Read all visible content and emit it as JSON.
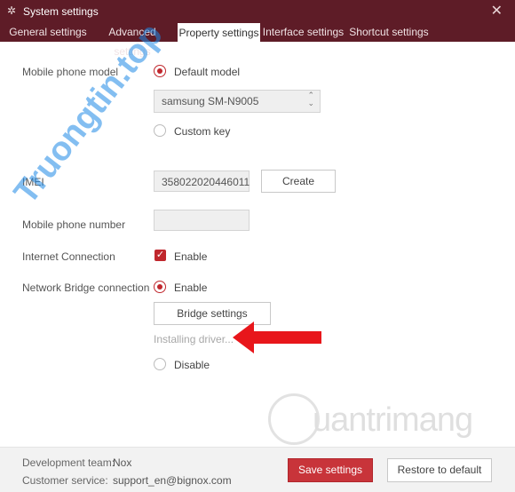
{
  "window": {
    "title": "System settings",
    "close_label": "✕"
  },
  "tabs": [
    {
      "label": "General settings"
    },
    {
      "label": "Advanced settings"
    },
    {
      "label": "Property settings"
    },
    {
      "label": "Interface settings"
    },
    {
      "label": "Shortcut settings"
    }
  ],
  "active_tab": "Property settings",
  "mobile_model": {
    "label": "Mobile phone model",
    "default_option": "Default model",
    "selected_model": "samsung SM-N9005",
    "custom_option": "Custom key",
    "selected": "Default model"
  },
  "imei": {
    "label": "IMEI",
    "value": "358022020446011",
    "create_label": "Create"
  },
  "phone_number": {
    "label": "Mobile phone number",
    "value": ""
  },
  "internet": {
    "label": "Internet Connection",
    "enable_label": "Enable",
    "checked": true
  },
  "bridge": {
    "label": "Network Bridge connection",
    "enable_label": "Enable",
    "settings_label": "Bridge settings",
    "status": "Installing driver...",
    "disable_label": "Disable",
    "selected": "Enable"
  },
  "footer": {
    "dev_team_label": "Development team:",
    "dev_team_value": "Nox",
    "service_label": "Customer service:",
    "service_value": "support_en@bignox.com",
    "save_label": "Save settings",
    "restore_label": "Restore to default"
  },
  "watermarks": {
    "primary": "Truongtin.top",
    "secondary": "uantrimang"
  },
  "icons": {
    "app": "gear-icon",
    "select": "chevron-updown-icon",
    "check": "checkmark-icon",
    "annotation": "red-arrow-icon"
  },
  "colors": {
    "titlebar": "#5e1c27",
    "accent": "#c0272d",
    "save_button": "#c8343a",
    "annotation_arrow": "#e8161b",
    "watermark_primary": "#1e88e5"
  }
}
